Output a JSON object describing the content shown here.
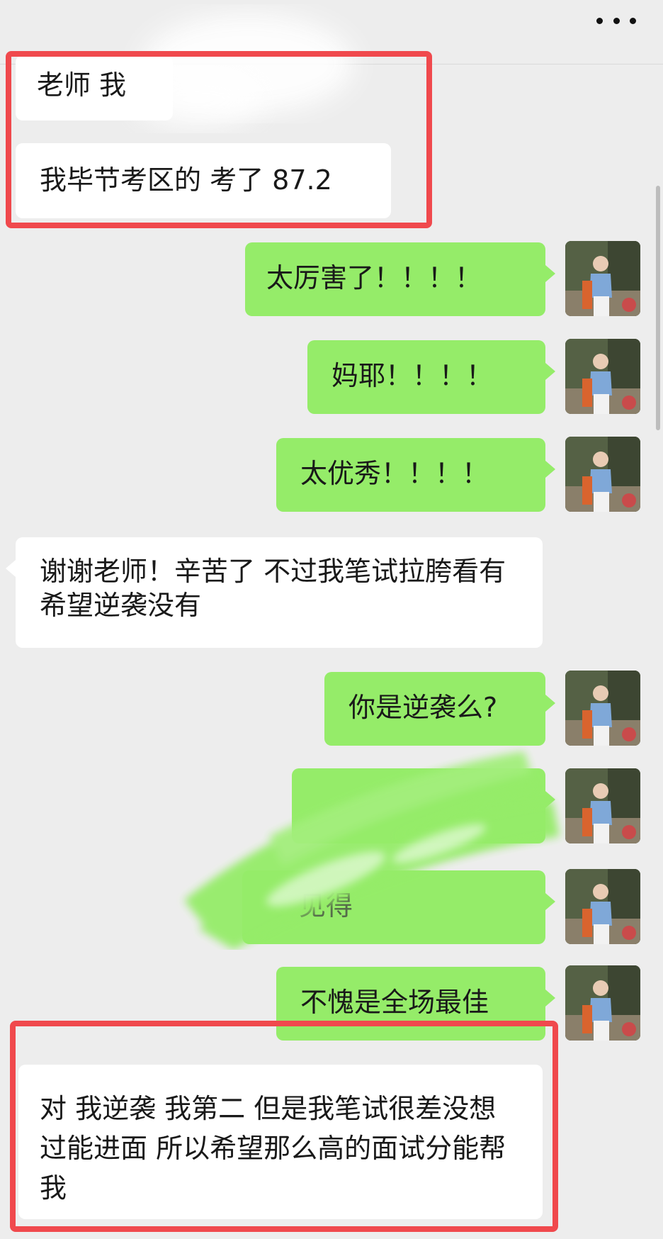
{
  "header": {
    "menu_icon": "more-dots-icon"
  },
  "messages": [
    {
      "side": "in",
      "text": "老师 我"
    },
    {
      "side": "in",
      "text": "我毕节考区的 考了 87.2"
    },
    {
      "side": "out",
      "text": "太厉害了！！！！"
    },
    {
      "side": "out",
      "text": "妈耶！！！！"
    },
    {
      "side": "out",
      "text": "太优秀！！！！"
    },
    {
      "side": "in",
      "text": "谢谢老师！辛苦了 不过我笔试拉胯看有希望逆袭没有"
    },
    {
      "side": "out",
      "text": "你是逆袭么?"
    },
    {
      "side": "out",
      "text": ""
    },
    {
      "side": "out",
      "text": "见得"
    },
    {
      "side": "out",
      "text": "不愧是全场最佳"
    },
    {
      "side": "in",
      "text": "对 我逆袭 我第二 但是我笔试很差没想过能进面 所以希望那么高的面试分能帮我"
    }
  ],
  "colors": {
    "incoming": "#ffffff",
    "outgoing": "#95ec69",
    "highlight": "#f0494d",
    "background": "#ededed"
  }
}
